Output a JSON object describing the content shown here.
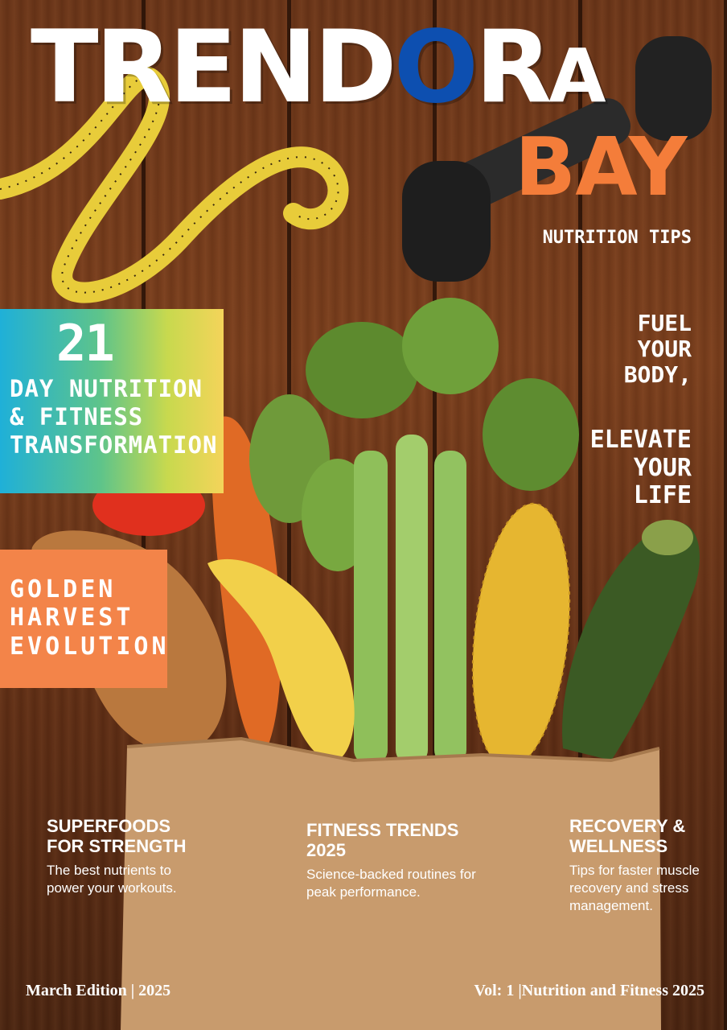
{
  "masthead": {
    "letters_white": "TREND",
    "letter_blue": "O",
    "letter_r": "R",
    "letter_small": "A",
    "subtitle": "BAY"
  },
  "right_column": {
    "tag": "NUTRITION TIPS",
    "tagline_1": "FUEL YOUR BODY,",
    "tagline_2": "ELEVATE YOUR LIFE"
  },
  "feature_box_21": {
    "number": "21",
    "title": "DAY NUTRITION & FITNESS TRANSFORMATION"
  },
  "feature_box_golden": {
    "title": "GOLDEN HARVEST EVOLUTION"
  },
  "articles": [
    {
      "headline": "SUPERFOODS FOR STRENGTH",
      "summary": "The best nutrients to power your workouts."
    },
    {
      "headline": "FITNESS TRENDS 2025",
      "summary": "Science-backed routines for peak performance."
    },
    {
      "headline": "RECOVERY & WELLNESS",
      "summary": "Tips for faster muscle recovery and stress management."
    }
  ],
  "footer": {
    "edition": "March Edition | 2025",
    "volume": "Vol: 1  |Nutrition and Fitness 2025"
  },
  "colors": {
    "brand_blue": "#0d4fb0",
    "accent_orange": "#f47d3a",
    "wood": "#6b3518"
  },
  "icons": [
    "measuring-tape",
    "dumbbell",
    "celery",
    "corn",
    "zucchini",
    "banana",
    "carrot",
    "tomato",
    "potato",
    "paper-bag"
  ]
}
